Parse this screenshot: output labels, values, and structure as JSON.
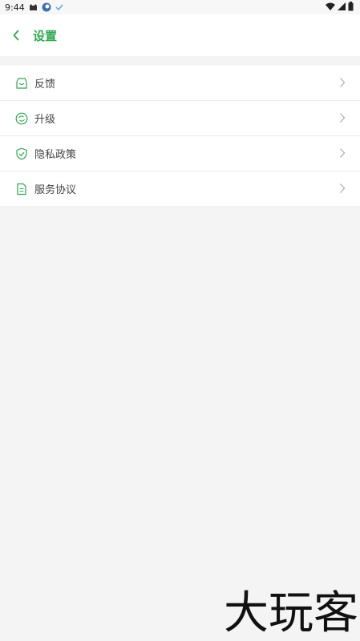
{
  "status_bar": {
    "time": "9:44"
  },
  "header": {
    "title": "设置"
  },
  "settings": [
    {
      "label": "反馈",
      "icon": "feedback-icon"
    },
    {
      "label": "升级",
      "icon": "upgrade-icon"
    },
    {
      "label": "隐私政策",
      "icon": "shield-check-icon"
    },
    {
      "label": "服务协议",
      "icon": "document-icon"
    }
  ],
  "colors": {
    "accent": "#2fa84f",
    "background": "#f4f4f4",
    "card": "#ffffff"
  },
  "watermark": "大玩客"
}
